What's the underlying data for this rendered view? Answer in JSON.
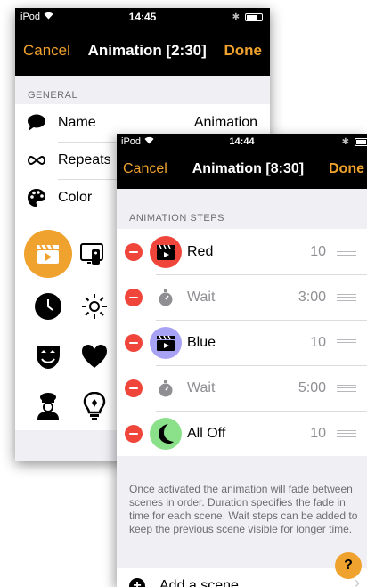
{
  "back": {
    "status": {
      "device": "iPod",
      "time": "14:45"
    },
    "nav": {
      "cancel": "Cancel",
      "title": "Animation [2:30]",
      "done": "Done"
    },
    "section": "GENERAL",
    "rows": [
      {
        "label": "Name",
        "value": "Animation",
        "icon": "speech-bubble-icon"
      },
      {
        "label": "Repeats",
        "value": "",
        "icon": "infinity-icon"
      },
      {
        "label": "Color",
        "value": "",
        "icon": "palette-icon"
      }
    ],
    "icons": [
      "clapperboard-icon",
      "remote-icon",
      "clock-icon",
      "sun-icon",
      "mask-icon",
      "heart-icon",
      "chef-icon",
      "lightbulb-icon"
    ]
  },
  "front": {
    "status": {
      "device": "iPod",
      "time": "14:44"
    },
    "nav": {
      "cancel": "Cancel",
      "title": "Animation [8:30]",
      "done": "Done"
    },
    "section": "ANIMATION STEPS",
    "steps": [
      {
        "name": "Red",
        "duration": "10",
        "type": "scene",
        "color": "#f0453a"
      },
      {
        "name": "Wait",
        "duration": "3:00",
        "type": "wait"
      },
      {
        "name": "Blue",
        "duration": "10",
        "type": "scene",
        "color": "#a8a2f5"
      },
      {
        "name": "Wait",
        "duration": "5:00",
        "type": "wait"
      },
      {
        "name": "All Off",
        "duration": "10",
        "type": "scene",
        "color": "#8be08a"
      }
    ],
    "footer": "Once activated the animation will fade between scenes in order. Duration specifies the fade in time for each scene. Wait steps can be added to keep the previous scene visible for longer time.",
    "add_scene": "Add a scene"
  },
  "help_label": "?",
  "colors": {
    "accent": "#f0a22e",
    "delete": "#f0453a"
  }
}
